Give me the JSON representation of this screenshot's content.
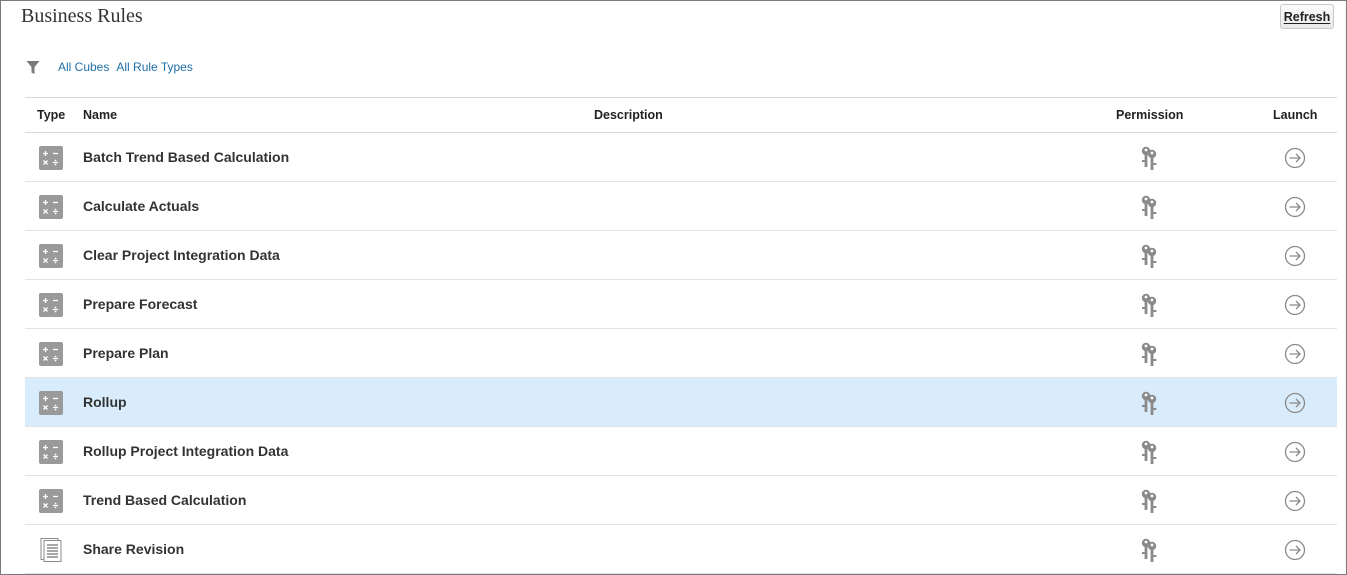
{
  "header": {
    "title": "Business Rules",
    "refresh_label": "Refresh"
  },
  "filters": {
    "cubes_label": "All Cubes",
    "rule_types_label": "All Rule Types"
  },
  "table": {
    "columns": {
      "type": "Type",
      "name": "Name",
      "description": "Description",
      "permission": "Permission",
      "launch": "Launch"
    },
    "rows": [
      {
        "type_icon": "calculator-icon",
        "name": "Batch Trend Based Calculation",
        "description": "",
        "selected": false
      },
      {
        "type_icon": "calculator-icon",
        "name": "Calculate Actuals",
        "description": "",
        "selected": false
      },
      {
        "type_icon": "calculator-icon",
        "name": "Clear Project Integration Data",
        "description": "",
        "selected": false
      },
      {
        "type_icon": "calculator-icon",
        "name": "Prepare Forecast",
        "description": "",
        "selected": false
      },
      {
        "type_icon": "calculator-icon",
        "name": "Prepare Plan",
        "description": "",
        "selected": false
      },
      {
        "type_icon": "calculator-icon",
        "name": "Rollup",
        "description": "",
        "selected": true
      },
      {
        "type_icon": "calculator-icon",
        "name": "Rollup Project Integration Data",
        "description": "",
        "selected": false
      },
      {
        "type_icon": "calculator-icon",
        "name": "Trend Based Calculation",
        "description": "",
        "selected": false
      },
      {
        "type_icon": "document-icon",
        "name": "Share Revision",
        "description": "",
        "selected": false
      }
    ]
  },
  "colors": {
    "link": "#1f6fa8",
    "selected_row": "#d9ecfb",
    "icon_gray": "#9a9a9a"
  }
}
